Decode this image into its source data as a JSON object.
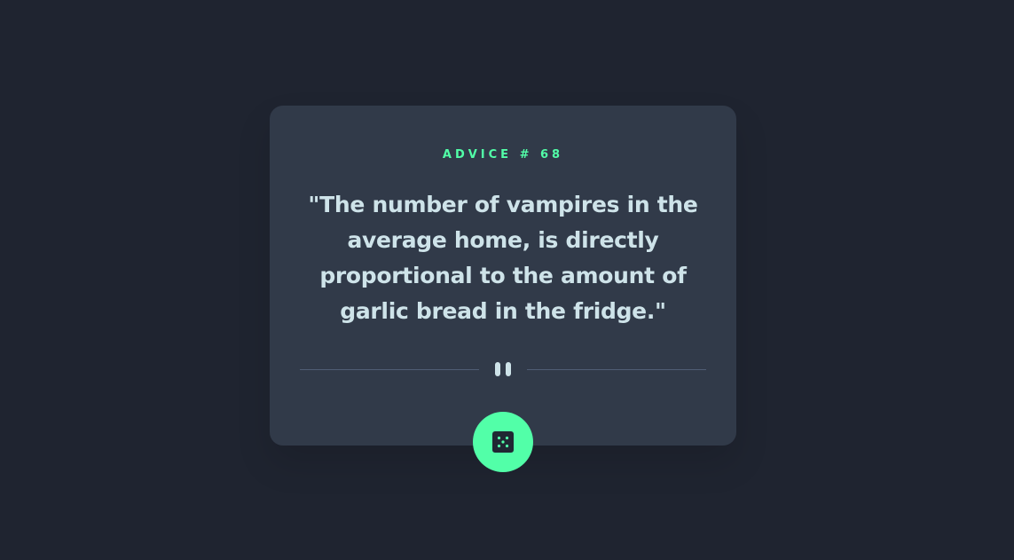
{
  "advice": {
    "label": "ADVICE # 68",
    "quote": "\"The number of vampires in the average home, is directly proportional to the amount of garlic bread in the fridge.\""
  },
  "divider": {
    "icon": "pause-icon"
  },
  "generate_button": {
    "icon": "dice-icon"
  },
  "colors": {
    "background": "#1f2430",
    "card": "#313a49",
    "accent": "#52ffa8",
    "text": "#cee3e9",
    "divider": "#4f5d74"
  }
}
